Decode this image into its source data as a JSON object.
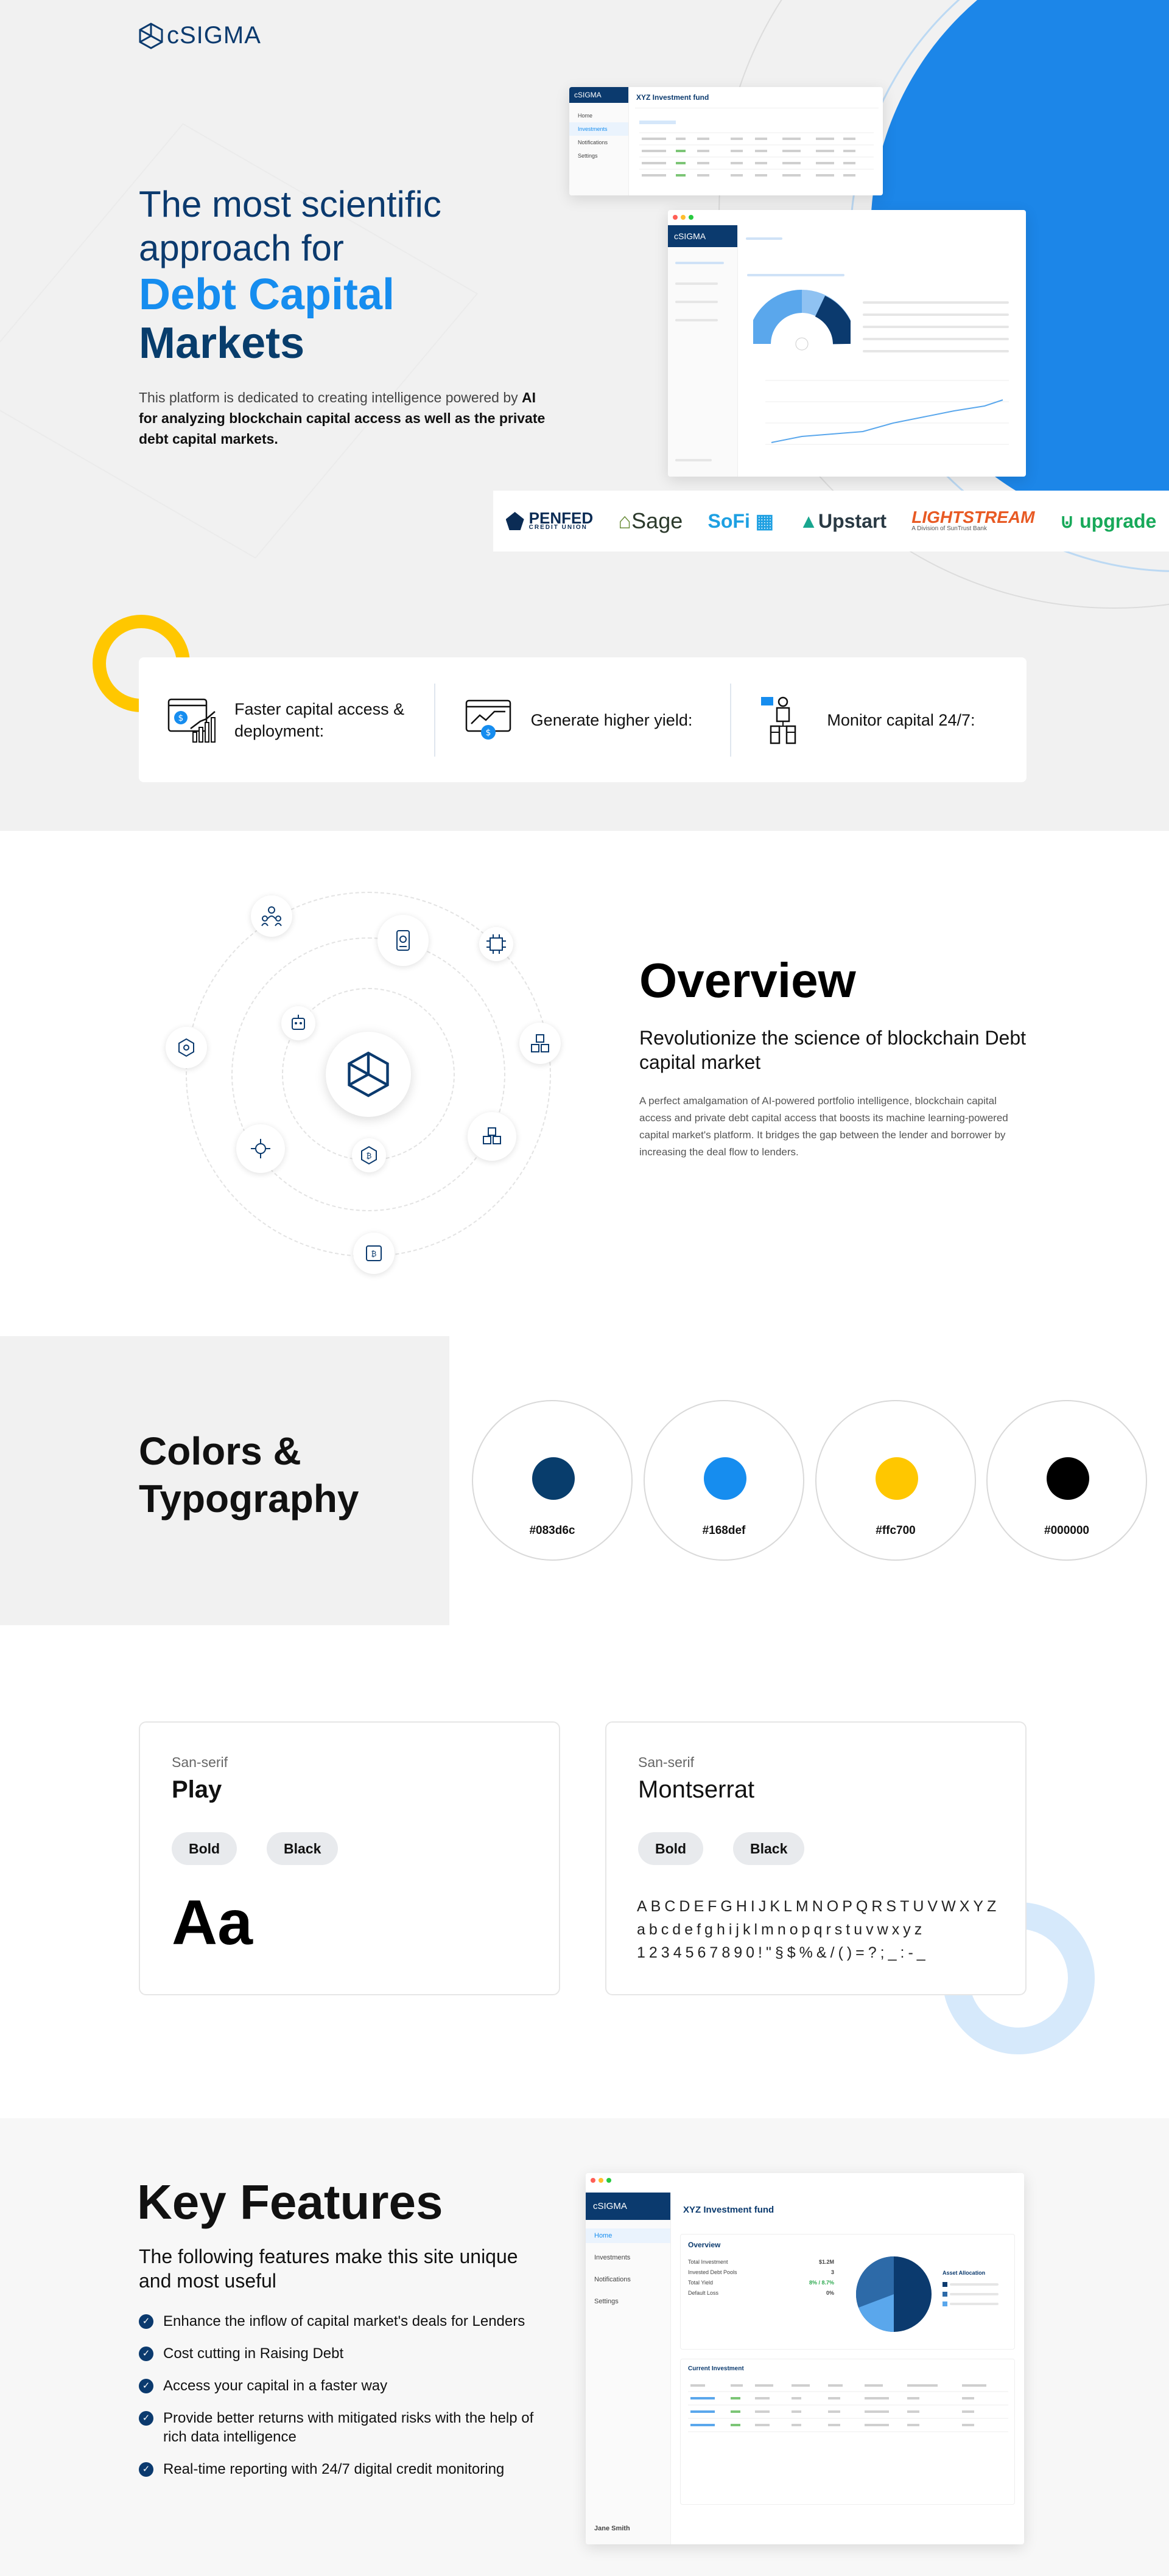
{
  "brand": {
    "name": "cSIGMA"
  },
  "colors": {
    "primary": "#083d6c",
    "accent": "#168def",
    "yellow": "#ffc700",
    "black": "#000000"
  },
  "hero": {
    "title_line1": "The most scientific",
    "title_line2": "approach for",
    "title_accent": "Debt Capital",
    "title_dark": "Markets",
    "desc_plain": "This platform is dedicated to creating intelligence powered by ",
    "desc_bold": "AI for analyzing blockchain capital access as well as the private debt capital markets."
  },
  "mock_top": {
    "brand": "cSIGMA",
    "title": "XYZ Investment fund",
    "nav": [
      "Home",
      "Investments",
      "Notifications",
      "Settings"
    ]
  },
  "mock_mid": {
    "brand": "cSIGMA"
  },
  "partners": [
    "PENFED",
    "Sage",
    "SoFi",
    "Upstart",
    "LIGHTSTREAM",
    "upgrade"
  ],
  "partner_sub": {
    "penfed": "CREDIT UNION",
    "lightstream": "A Division of SunTrust Bank"
  },
  "benefits": [
    {
      "label": "Faster capital access & deployment:"
    },
    {
      "label": "Generate higher yield:"
    },
    {
      "label": "Monitor capital 24/7:"
    }
  ],
  "overview": {
    "title": "Overview",
    "subtitle": "Revolutionize the science of blockchain Debt capital market",
    "desc": "A perfect amalgamation of AI-powered portfolio intelligence, blockchain capital access and private debt capital access that boosts its machine learning-powered capital market's platform. It bridges the gap between the lender and borrower by increasing the deal flow to lenders."
  },
  "palette": {
    "title_line1": "Colors &",
    "title_line2": "Typography",
    "swatches": [
      {
        "hex": "#083d6c"
      },
      {
        "hex": "#168def"
      },
      {
        "hex": "#ffc700"
      },
      {
        "hex": "#000000"
      }
    ]
  },
  "typography": [
    {
      "category": "San-serif",
      "name": "Play",
      "weights": [
        "Bold",
        "Black"
      ],
      "sample": "Aa"
    },
    {
      "category": "San-serif",
      "name": "Montserrat",
      "weights": [
        "Bold",
        "Black"
      ],
      "upper": "ABCDEFGHIJKLMNOPQRSTUVWXYZ",
      "lower": "abcdefghijklmnopqrstuvwxyz",
      "digits": "1234567890!\"§$%&/()=?;_:-_"
    }
  ],
  "features": {
    "title": "Key Features",
    "subtitle": "The following features make this site unique and most useful",
    "items": [
      "Enhance the inflow of capital market's deals for Lenders",
      "Cost cutting in Raising Debt",
      "Access your capital in a faster way",
      "Provide better returns with mitigated risks with the help of rich data intelligence",
      "Real-time reporting with 24/7 digital credit monitoring"
    ]
  },
  "mock_features": {
    "brand": "cSIGMA",
    "title": "XYZ Investment fund",
    "nav": [
      "Home",
      "Investments",
      "Notifications",
      "Settings"
    ],
    "user": "Jane Smith",
    "overview_label": "Overview",
    "stats": [
      {
        "label": "Total Investment",
        "value": "$1.2M"
      },
      {
        "label": "Invested Debt Pools",
        "value": "3"
      },
      {
        "label": "Total Yield",
        "value": "8% / 8.7%"
      },
      {
        "label": "Default Loss",
        "value": "0%"
      }
    ],
    "asset_allocation": "Asset Allocation",
    "current_investment": "Current Investment"
  }
}
